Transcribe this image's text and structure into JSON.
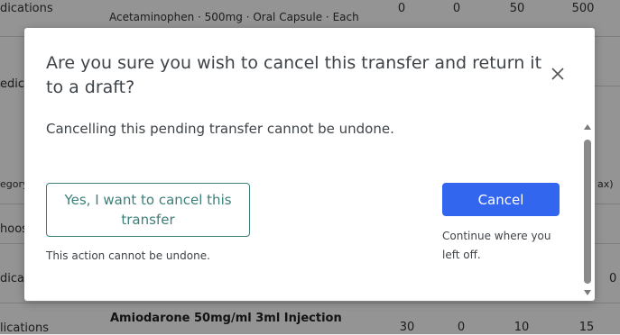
{
  "background": {
    "rows": [
      {
        "category": "dications",
        "drug_name": "",
        "drug_detail": "Acetaminophen · 500mg · Oral Capsule · Each",
        "values": [
          "0",
          "0",
          "50",
          "500"
        ]
      },
      {
        "category": "edica",
        "drug_name": "",
        "drug_detail": "",
        "values": []
      },
      {
        "category": "egory",
        "drug_name": "",
        "drug_detail": "",
        "values": [
          "ax)"
        ]
      },
      {
        "category": "hoos",
        "drug_name": "",
        "drug_detail": "",
        "values": []
      },
      {
        "category": "dica",
        "drug_name": "",
        "drug_detail": "",
        "values": [
          "0"
        ]
      },
      {
        "category": "lications",
        "drug_name": "Amiodarone 50mg/ml 3ml Injection",
        "drug_detail": "",
        "values": [
          "30",
          "0",
          "10",
          "15"
        ]
      }
    ]
  },
  "modal": {
    "title": "Are you sure you wish to cancel this transfer and return it to a draft?",
    "body": "Cancelling this pending transfer cannot be undone.",
    "confirm_button": "Yes, I want to cancel this transfer",
    "confirm_note": "This action cannot be undone.",
    "cancel_button": "Cancel",
    "cancel_note": "Continue where you left off.",
    "icons": {
      "close": "close-icon",
      "scroll_up": "scroll-up-arrow-icon",
      "scroll_down": "scroll-down-arrow-icon"
    }
  },
  "colors": {
    "primary": "#3366ee",
    "secondary_outline": "#3d7f7a",
    "text": "#3f4449",
    "overlay": "rgba(0,0,0,0.42)"
  }
}
